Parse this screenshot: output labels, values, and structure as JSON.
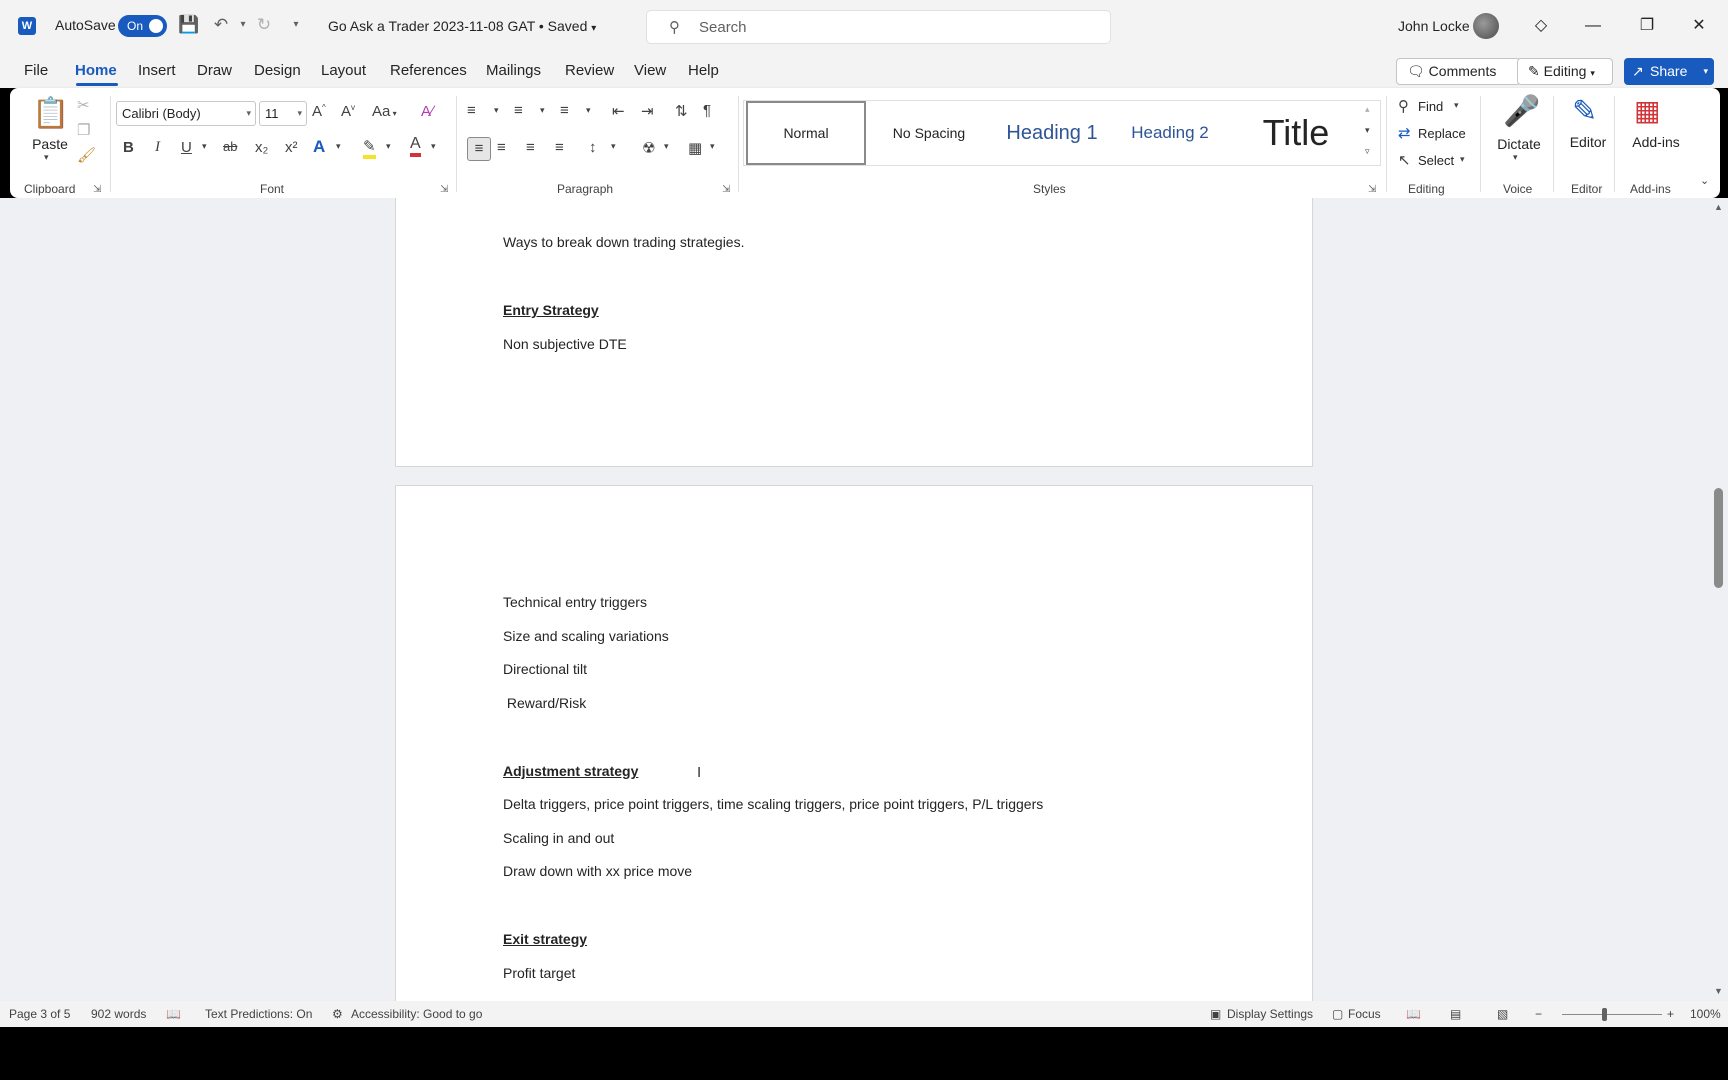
{
  "titlebar": {
    "autosave_label": "AutoSave",
    "autosave_state": "On",
    "doc_title": "Go Ask a Trader 2023-11-08 GAT • Saved",
    "search_placeholder": "Search",
    "user_name": "John Locke"
  },
  "menu": {
    "tabs": [
      "File",
      "Home",
      "Insert",
      "Draw",
      "Design",
      "Layout",
      "References",
      "Mailings",
      "Review",
      "View",
      "Help"
    ],
    "comments_label": "Comments",
    "editing_label": "Editing",
    "share_label": "Share"
  },
  "ribbon": {
    "clipboard": {
      "paste": "Paste",
      "label": "Clipboard"
    },
    "font": {
      "name": "Calibri (Body)",
      "size": "11",
      "aa_label": "Aa",
      "label": "Font",
      "bold": "B",
      "italic": "I",
      "underline": "U",
      "strike": "ab",
      "subscript": "x₂",
      "superscript": "x²"
    },
    "paragraph": {
      "label": "Paragraph"
    },
    "styles": {
      "items": [
        "Normal",
        "No Spacing",
        "Heading 1",
        "Heading 2",
        "Title"
      ],
      "label": "Styles"
    },
    "editing": {
      "find": "Find",
      "replace": "Replace",
      "select": "Select",
      "label": "Editing"
    },
    "voice": {
      "dictate": "Dictate",
      "label": "Voice"
    },
    "editor": {
      "editor": "Editor",
      "label": "Editor"
    },
    "addins": {
      "addins": "Add-ins",
      "label": "Add-ins"
    }
  },
  "document": {
    "page1_lines": [
      "Ways to break down trading strategies.",
      "Entry Strategy",
      "Non subjective DTE"
    ],
    "page2_lines": [
      "Technical entry triggers",
      "Size and scaling variations",
      "Directional tilt",
      " Reward/Risk",
      "Adjustment strategy",
      "Delta triggers, price point triggers, time scaling triggers, price point triggers, P/L triggers",
      "Scaling in and out",
      "Draw down with xx price move",
      "Exit strategy",
      "Profit target"
    ]
  },
  "status": {
    "page": "Page 3 of 5",
    "words": "902 words",
    "text_predictions": "Text Predictions: On",
    "accessibility": "Accessibility: Good to go",
    "display_settings": "Display Settings",
    "focus": "Focus",
    "zoom": "100%"
  },
  "colors": {
    "accent": "#185abd",
    "ribbon_bg": "#ffffff",
    "chrome_bg": "#f3f3f3",
    "canvas_bg": "#eef0f3"
  }
}
